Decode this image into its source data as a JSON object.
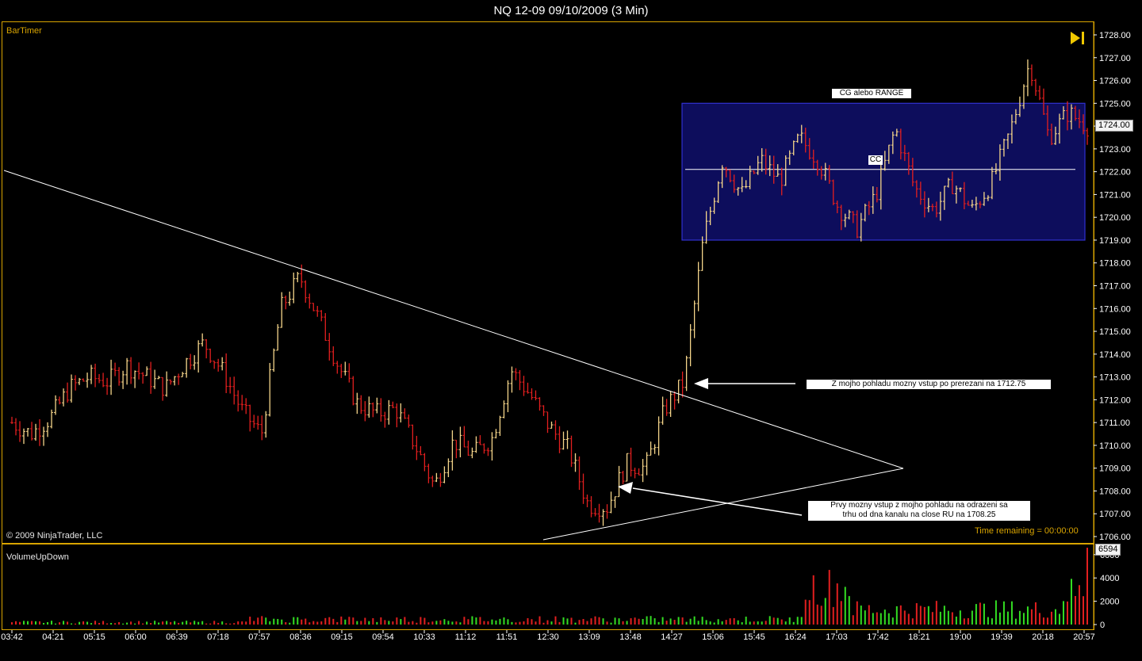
{
  "window": {
    "title": "NQ 12-09  09/10/2009 (3 Min)"
  },
  "panel_price": {
    "indicator_label": "BarTimer",
    "copyright": "© 2009 NinjaTrader, LLC",
    "time_remaining": "Time remaining = 00:00:00",
    "current_price_tag": "1724.00"
  },
  "panel_volume": {
    "indicator_label": "VolumeUpDown",
    "current_volume_tag": "6594"
  },
  "annotations": {
    "range_box_label": "CG alebo RANGE",
    "center_line_label": "CC",
    "entry1_line1": "Z mojho pohladu mozny vstup po prerezani na 1712.75",
    "entry2_line1": "Prvy mozny vstup z mojho pohladu na odrazeni sa",
    "entry2_line2": "trhu od dna kanalu na close RU na 1708.25"
  },
  "colors": {
    "background": "#000000",
    "frame": "#d9a400",
    "up_bar": "#f5d58a",
    "down_bar": "#e21f1f",
    "volume_up": "#33dd22",
    "volume_down": "#e21f1f",
    "range_box_fill": "#0d0d5c",
    "range_box_stroke": "#3030d0",
    "trendline": "#ffffff"
  },
  "chart_data": [
    {
      "type": "candlestick",
      "name": "NQ 12-09 3 Min",
      "y_ticks": [
        "1706.00",
        "1707.00",
        "1708.00",
        "1709.00",
        "1710.00",
        "1711.00",
        "1712.00",
        "1713.00",
        "1714.00",
        "1715.00",
        "1716.00",
        "1717.00",
        "1718.00",
        "1719.00",
        "1720.00",
        "1721.00",
        "1722.00",
        "1723.00",
        "1724.00",
        "1725.00",
        "1726.00",
        "1727.00",
        "1728.00"
      ],
      "ylim": [
        1706,
        1728
      ],
      "x_ticks": [
        "03:42",
        "04:21",
        "05:15",
        "06:00",
        "06:39",
        "07:18",
        "07:57",
        "08:36",
        "09:15",
        "09:54",
        "10:33",
        "11:12",
        "11:51",
        "12:30",
        "13:09",
        "13:48",
        "14:27",
        "15:06",
        "15:45",
        "16:24",
        "17:03",
        "17:42",
        "18:21",
        "19:00",
        "19:39",
        "20:18",
        "20:57"
      ],
      "close_path": [
        1711,
        1710.5,
        1711.2,
        1712.5,
        1713,
        1712.8,
        1713.5,
        1713,
        1712.5,
        1713.6,
        1714.5,
        1713.2,
        1711.5,
        1710.5,
        1716,
        1717.4,
        1715.5,
        1713.5,
        1711.8,
        1711.4,
        1711.6,
        1710,
        1708.2,
        1710.2,
        1709.6,
        1710.3,
        1713.3,
        1712.2,
        1710.8,
        1709.8,
        1707.4,
        1707.3,
        1709.2,
        1709,
        1711.6,
        1712.8,
        1719,
        1722.5,
        1721,
        1722.5,
        1721.6,
        1723.5,
        1722.5,
        1720.5,
        1719.5,
        1721,
        1723.9,
        1721.3,
        1720.3,
        1721.5,
        1720.3,
        1721.5,
        1723.8,
        1726.8,
        1723.5,
        1724.6,
        1724.0
      ],
      "range_box": {
        "low": 1719.0,
        "high": 1725.0,
        "center": 1722.1,
        "label": "CG alebo RANGE",
        "center_label": "CC"
      },
      "annotated_levels": [
        1712.75,
        1708.25
      ]
    },
    {
      "type": "bar",
      "name": "VolumeUpDown",
      "y_ticks": [
        "0",
        "2000",
        "4000",
        "6000"
      ],
      "ylim": [
        0,
        6600
      ],
      "last_value": 6594
    }
  ]
}
